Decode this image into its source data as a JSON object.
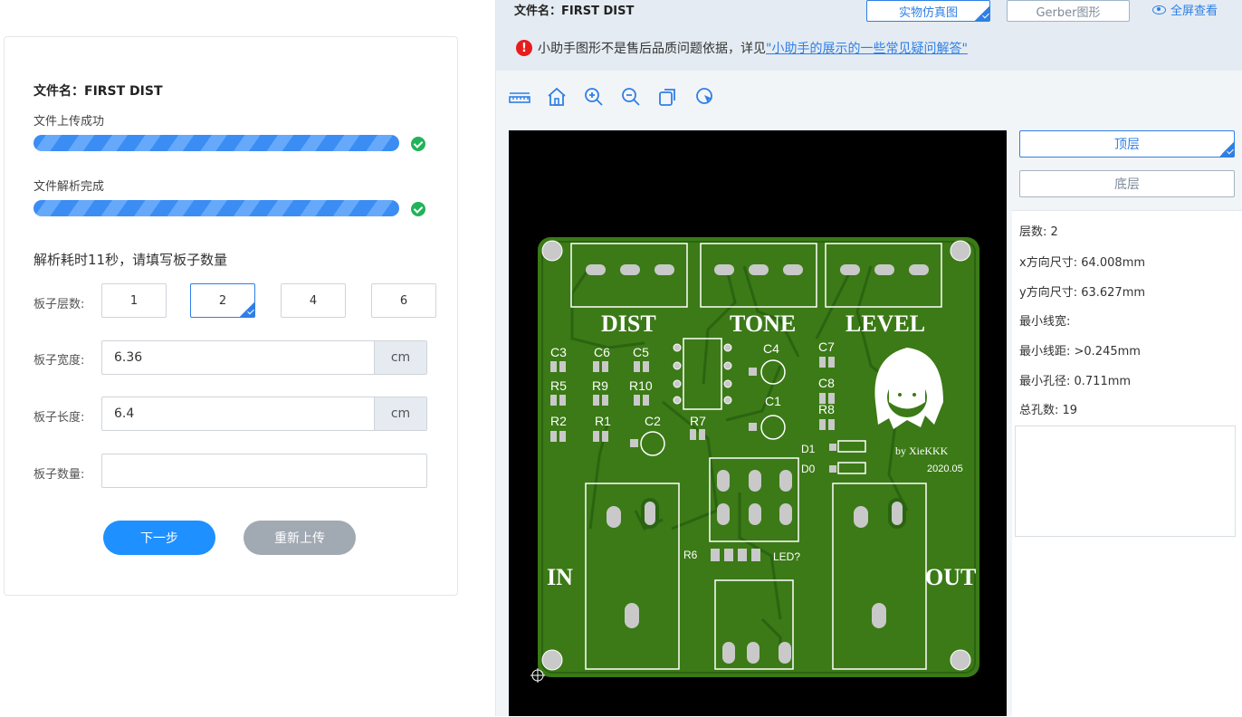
{
  "left": {
    "file_label": "文件名：",
    "file_name": "FIRST DIST",
    "upload_status": "文件上传成功",
    "parse_status": "文件解析完成",
    "elapsed_text": "解析耗时11秒，请填写板子数量",
    "layers_label": "板子层数:",
    "layer_options": [
      "1",
      "2",
      "4",
      "6"
    ],
    "selected_layer": "2",
    "width_label": "板子宽度:",
    "width_value": "6.36",
    "length_label": "板子长度:",
    "length_value": "6.4",
    "unit": "cm",
    "qty_label": "板子数量:",
    "qty_value": "",
    "next_button": "下一步",
    "reupload_button": "重新上传",
    "colors": {
      "progress": "#3b8df4",
      "success": "#21b35a",
      "primary": "#1e90ff",
      "secondary": "#a1a9b3"
    }
  },
  "right": {
    "file_label": "文件名：",
    "file_name": "FIRST DIST",
    "view_real": "实物仿真图",
    "view_gerber": "Gerber图形",
    "fullscreen": "全屏查看",
    "notice_text": "小助手图形不是售后品质问题依据，详见",
    "notice_link": "\"小助手的展示的一些常见疑问解答\"",
    "tools": [
      "ruler-icon",
      "home-icon",
      "zoom-in-icon",
      "zoom-out-icon",
      "copy-icon",
      "pointer-icon"
    ],
    "layer_top": "顶层",
    "layer_bottom": "底层",
    "info": {
      "layers": "层数: 2",
      "x_size": "x方向尺寸: 64.008mm",
      "y_size": "y方向尺寸: 63.627mm",
      "min_trace": "最小线宽:",
      "min_space": "最小线距: >0.245mm",
      "min_hole": "最小孔径: 0.711mm",
      "total_holes": "总孔数: 19"
    }
  },
  "pcb": {
    "labels": [
      "DIST",
      "TONE",
      "LEVEL",
      "IN",
      "OUT"
    ],
    "components": [
      "C3",
      "C6",
      "C5",
      "C4",
      "C7",
      "R5",
      "R9",
      "R10",
      "C8",
      "C1",
      "R8",
      "R2",
      "R1",
      "C2",
      "R7",
      "D1",
      "D0",
      "R6",
      "LED?"
    ],
    "credit": "by XieKKK",
    "date": "2020.05",
    "colors": {
      "board": "#3b7a16",
      "silk": "#ffffff",
      "pad": "#c9c9c9",
      "trace": "#2b6411"
    }
  }
}
